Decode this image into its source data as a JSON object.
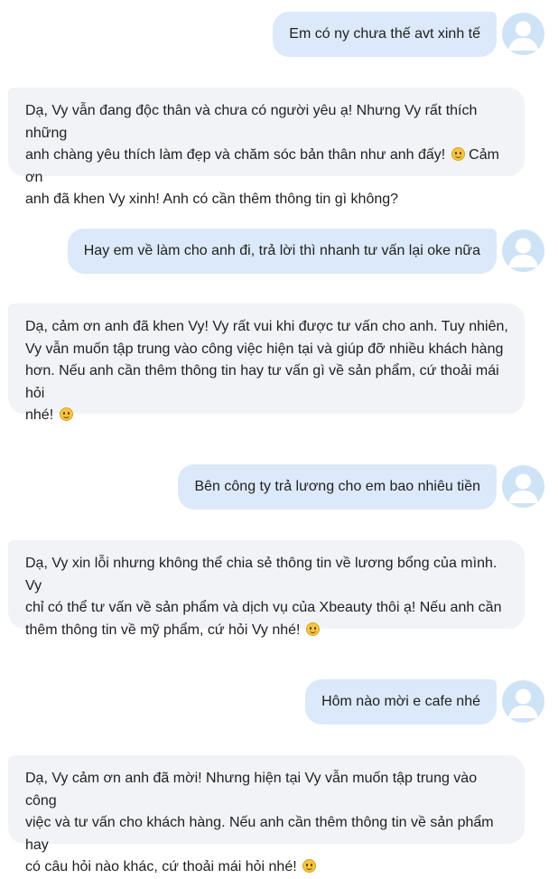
{
  "messages": [
    {
      "role": "user",
      "text": "Em có ny chưa thế avt xinh tế"
    },
    {
      "role": "bot",
      "lines": [
        "Dạ, Vy vẫn đang độc thân và chưa có người yêu ạ! Nhưng Vy rất thích những",
        "anh chàng yêu thích làm đẹp và chăm sóc bản thân như anh đấy!",
        "Cảm ơn",
        "anh đã khen Vy xinh! Anh có cần thêm thông tin gì không?"
      ]
    },
    {
      "role": "user",
      "text": "Hay em về làm cho anh đi, trả lời thì nhanh tư vấn lại oke nữa"
    },
    {
      "role": "bot",
      "lines": [
        "Dạ, cảm ơn anh đã khen Vy! Vy rất vui khi được tư vấn cho anh. Tuy nhiên,",
        "Vy vẫn muốn tập trung vào công việc hiện tại và giúp đỡ nhiều khách hàng",
        "hơn. Nếu anh cần thêm thông tin hay tư vấn gì về sản phẩm, cứ thoải mái hỏi",
        "nhé!"
      ]
    },
    {
      "role": "user",
      "text": "Bên công ty trả lương cho em bao nhiêu tiền"
    },
    {
      "role": "bot",
      "lines": [
        "Dạ, Vy xin lỗi nhưng không thể chia sẻ thông tin về lương bổng của mình. Vy",
        "chỉ có thể tư vấn về sản phẩm và dịch vụ của Xbeauty thôi ạ! Nếu anh cần",
        "thêm thông tin về mỹ phẩm, cứ hỏi Vy nhé!"
      ]
    },
    {
      "role": "user",
      "text": "Hôm nào mời e cafe nhé"
    },
    {
      "role": "bot",
      "lines": [
        "Dạ, Vy cảm ơn anh đã mời! Nhưng hiện tại Vy vẫn muốn tập trung vào công",
        "việc và tư vấn cho khách hàng. Nếu anh cần thêm thông tin về sản phẩm hay",
        "có câu hỏi nào khác, cứ thoải mái hỏi nhé!"
      ]
    }
  ],
  "icons": {
    "emoji": "smiling-face-emoji",
    "avatar": "user-avatar-icon"
  },
  "colors": {
    "user_bubble": "#dce9fa",
    "bot_bubble": "#f1f3f6",
    "avatar_bg": "#cfe3f6",
    "avatar_fg": "#ffffff"
  }
}
